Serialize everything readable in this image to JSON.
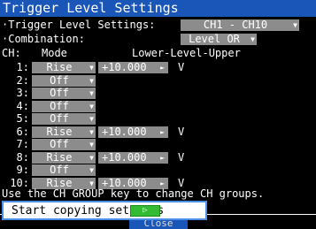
{
  "title": "Trigger Level Settings",
  "trigger_level_settings": {
    "label": "·Trigger Level Settings:",
    "value": "CH1 - CH10"
  },
  "combination": {
    "label": "·Combination:",
    "value": "Level OR"
  },
  "columns": {
    "ch": "CH:",
    "mode": "Mode",
    "range": "Lower-Level-Upper"
  },
  "channels": [
    {
      "ch": "1:",
      "mode": "Rise",
      "value": "+10.000",
      "unit": "V"
    },
    {
      "ch": "2:",
      "mode": "Off"
    },
    {
      "ch": "3:",
      "mode": "Off"
    },
    {
      "ch": "4:",
      "mode": "Off"
    },
    {
      "ch": "5:",
      "mode": "Off"
    },
    {
      "ch": "6:",
      "mode": "Rise",
      "value": "+10.000",
      "unit": "V"
    },
    {
      "ch": "7:",
      "mode": "Off"
    },
    {
      "ch": "8:",
      "mode": "Rise",
      "value": "+10.000",
      "unit": "V"
    },
    {
      "ch": "9:",
      "mode": "Off"
    },
    {
      "ch": "10:",
      "mode": "Rise",
      "value": "+10.000",
      "unit": "V"
    }
  ],
  "hint": "Use the CH GROUP key to change CH groups.",
  "copy_settings": {
    "label": "Start copying settings",
    "button_glyph": "▷"
  },
  "close_label": "Close",
  "glyphs": {
    "dropdown": "▼",
    "right": "►"
  },
  "colors": {
    "title_bar": "#1a56b8",
    "field": "#8c8c8c",
    "focus_border": "#4d8fe6",
    "start_button": "#33bb33"
  }
}
